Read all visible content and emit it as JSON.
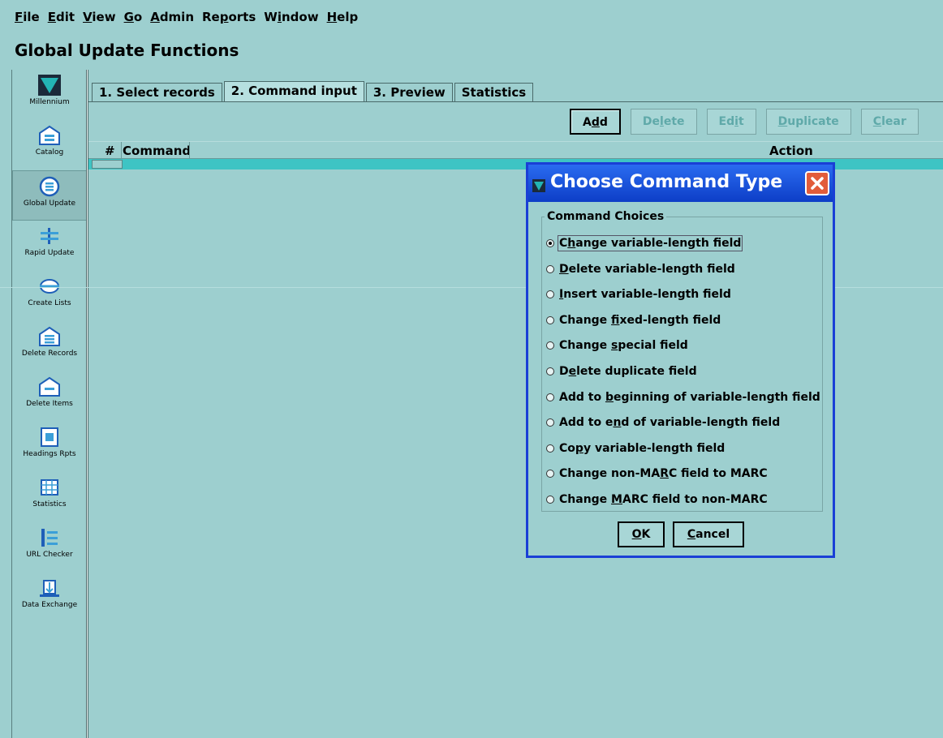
{
  "menubar": [
    {
      "pre": "",
      "key": "F",
      "post": "ile"
    },
    {
      "pre": "",
      "key": "E",
      "post": "dit"
    },
    {
      "pre": "",
      "key": "V",
      "post": "iew"
    },
    {
      "pre": "",
      "key": "G",
      "post": "o"
    },
    {
      "pre": "",
      "key": "A",
      "post": "dmin"
    },
    {
      "pre": "Re",
      "key": "p",
      "post": "orts"
    },
    {
      "pre": "W",
      "key": "i",
      "post": "ndow"
    },
    {
      "pre": "",
      "key": "H",
      "post": "elp"
    }
  ],
  "page_title": "Global Update Functions",
  "sidebar": {
    "items": [
      {
        "label": "Millennium",
        "icon": "millennium-logo-icon"
      },
      {
        "label": "Catalog",
        "icon": "catalog-icon"
      },
      {
        "label": "Global Update",
        "icon": "global-update-icon"
      },
      {
        "label": "Rapid Update",
        "icon": "rapid-update-icon"
      },
      {
        "label": "Create Lists",
        "icon": "create-lists-icon"
      },
      {
        "label": "Delete Records",
        "icon": "delete-records-icon"
      },
      {
        "label": "Delete Items",
        "icon": "delete-items-icon"
      },
      {
        "label": "Headings Rpts",
        "icon": "headings-reports-icon"
      },
      {
        "label": "Statistics",
        "icon": "statistics-icon"
      },
      {
        "label": "URL Checker",
        "icon": "url-checker-icon"
      },
      {
        "label": "Data Exchange",
        "icon": "data-exchange-icon"
      }
    ],
    "active": "Global Update"
  },
  "tabs": [
    {
      "label": "1. Select records"
    },
    {
      "label": "2. Command input"
    },
    {
      "label": "3. Preview"
    },
    {
      "label": "Statistics"
    }
  ],
  "active_tab": "2. Command input",
  "toolbar": {
    "add": {
      "pre": "A",
      "key": "d",
      "post": "d"
    },
    "delete": {
      "pre": "De",
      "key": "l",
      "post": "ete"
    },
    "edit": {
      "pre": "Ed",
      "key": "i",
      "post": "t"
    },
    "duplicate": {
      "pre": "",
      "key": "D",
      "post": "uplicate"
    },
    "clear": {
      "pre": "",
      "key": "C",
      "post": "lear"
    }
  },
  "grid": {
    "columns": {
      "num": "#",
      "command": "Command",
      "action": "Action"
    }
  },
  "dialog": {
    "title": "Choose Command Type",
    "group_label": "Command Choices",
    "choices": [
      {
        "pre": "C",
        "key": "h",
        "post": "ange variable-length field",
        "checked": true
      },
      {
        "pre": "",
        "key": "D",
        "post": "elete variable-length field",
        "checked": false
      },
      {
        "pre": "",
        "key": "I",
        "post": "nsert variable-length field",
        "checked": false
      },
      {
        "pre": "Change ",
        "key": "f",
        "post": "ixed-length field",
        "checked": false
      },
      {
        "pre": "Change ",
        "key": "s",
        "post": "pecial field",
        "checked": false
      },
      {
        "pre": "D",
        "key": "e",
        "post": "lete duplicate field",
        "checked": false
      },
      {
        "pre": "Add to ",
        "key": "b",
        "post": "eginning of variable-length field",
        "checked": false
      },
      {
        "pre": "Add to e",
        "key": "n",
        "post": "d of variable-length field",
        "checked": false
      },
      {
        "pre": "Co",
        "key": "p",
        "post": "y variable-length field",
        "checked": false
      },
      {
        "pre": "Change non-MA",
        "key": "R",
        "post": "C field to MARC",
        "checked": false
      },
      {
        "pre": "Change ",
        "key": "M",
        "post": "ARC field to non-MARC",
        "checked": false
      }
    ],
    "ok": {
      "pre": "",
      "key": "O",
      "post": "K"
    },
    "cancel": {
      "pre": "",
      "key": "C",
      "post": "ancel"
    }
  }
}
